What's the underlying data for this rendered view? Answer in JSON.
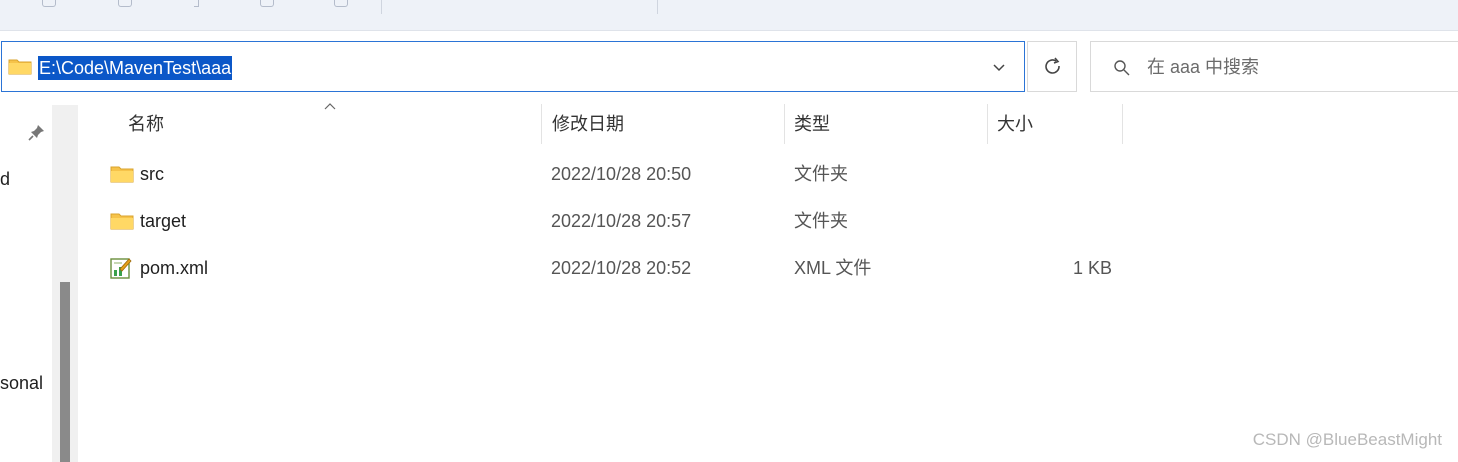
{
  "address_bar": {
    "path": "E:\\Code\\MavenTest\\aaa"
  },
  "search": {
    "placeholder": "在 aaa 中搜索"
  },
  "nav_pane": {
    "items": [
      "d",
      "sonal"
    ]
  },
  "file_list": {
    "columns": [
      "名称",
      "修改日期",
      "类型",
      "大小"
    ],
    "rows": [
      {
        "name": "src",
        "modified": "2022/10/28 20:50",
        "type": "文件夹",
        "size": "",
        "icon": "folder-icon"
      },
      {
        "name": "target",
        "modified": "2022/10/28 20:57",
        "type": "文件夹",
        "size": "",
        "icon": "folder-icon"
      },
      {
        "name": "pom.xml",
        "modified": "2022/10/28 20:52",
        "type": "XML 文件",
        "size": "1 KB",
        "icon": "xml-file-icon"
      }
    ]
  },
  "watermark": "CSDN @BlueBeastMight",
  "colors": {
    "accent": "#2b74d6",
    "selection": "#0b57c8",
    "folder": "#f6c34a"
  }
}
